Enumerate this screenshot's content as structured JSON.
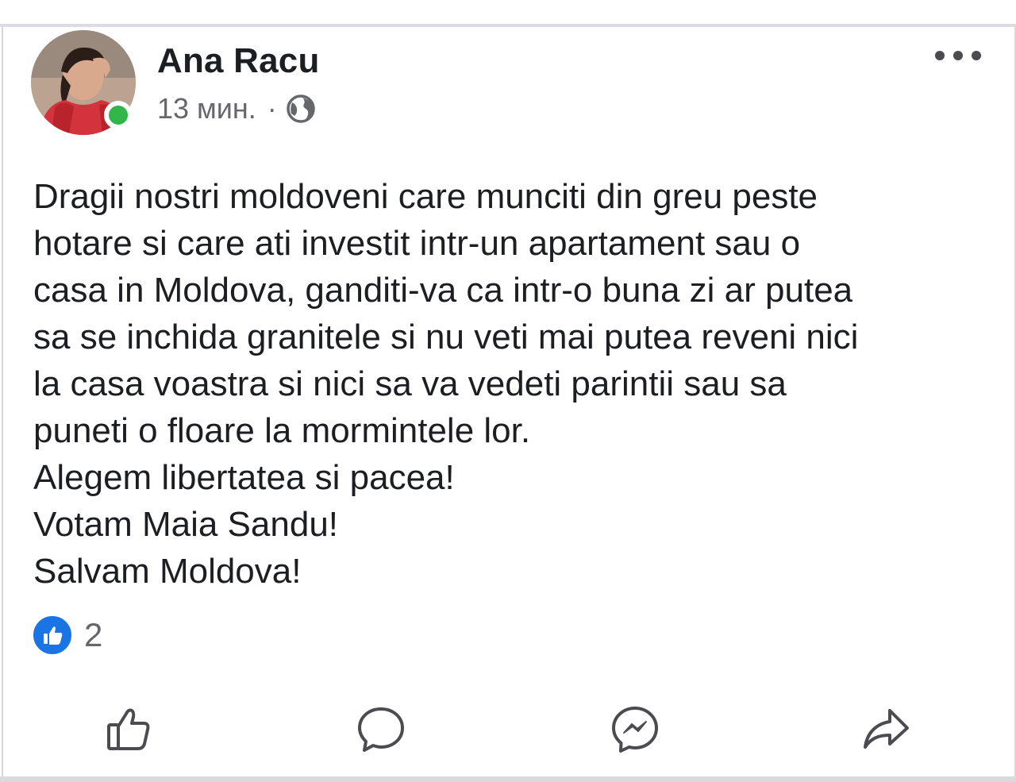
{
  "post": {
    "author": "Ana Racu",
    "time": "13 мин.",
    "separator": "·",
    "privacy_icon": "globe-icon",
    "online_status_color": "#31b64a",
    "text_lines": [
      "Dragii nostri moldoveni care munciti din greu peste",
      "hotare si care ati investit intr-un apartament sau o",
      "casa in Moldova, ganditi-va ca intr-o buna zi ar putea",
      "sa se inchida granitele si nu veti mai putea reveni nici",
      "la casa voastra si nici sa va vedeti parintii sau sa",
      "puneti o floare la mormintele lor.",
      "Alegem libertatea si pacea!",
      "Votam Maia Sandu!",
      "Salvam Moldova!"
    ],
    "reactions": {
      "icon": "like-reaction-icon",
      "count": "2",
      "color": "#1b74e4"
    },
    "actions": [
      {
        "icon": "thumbs-up-icon"
      },
      {
        "icon": "comment-bubble-icon"
      },
      {
        "icon": "messenger-icon"
      },
      {
        "icon": "share-arrow-icon"
      }
    ],
    "more_icon": "more-options-icon"
  }
}
